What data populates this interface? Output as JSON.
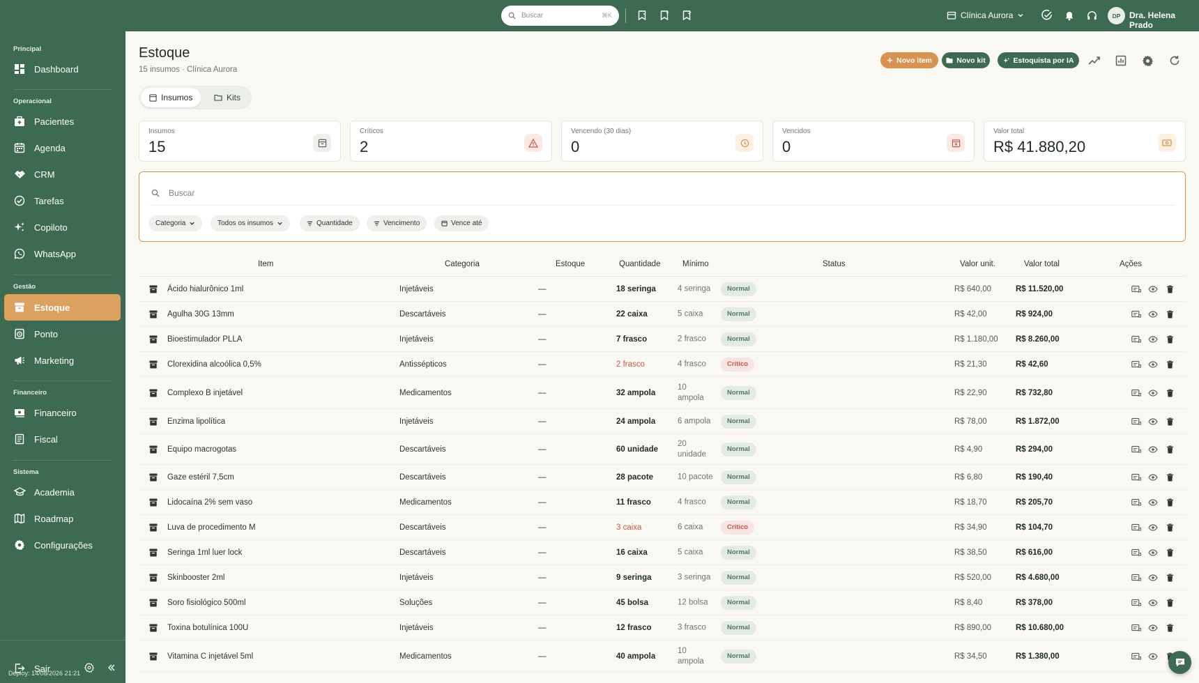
{
  "topbar": {
    "search_placeholder": "Buscar",
    "search_shortcut": "⌘K",
    "clinic_name": "Clínica Aurora",
    "user_initials": "DP",
    "user_name": "Dra. Helena Prado"
  },
  "sidebar": {
    "groups": {
      "principal": "Principal",
      "operacional": "Operacional",
      "gestao": "Gestão",
      "financeiro": "Financeiro",
      "sistema": "Sistema"
    },
    "items": {
      "dashboard": "Dashboard",
      "pacientes": "Pacientes",
      "agenda": "Agenda",
      "crm": "CRM",
      "tarefas": "Tarefas",
      "copiloto": "Copiloto",
      "whatsapp": "WhatsApp",
      "estoque": "Estoque",
      "ponto": "Ponto",
      "marketing": "Marketing",
      "financeiro": "Financeiro",
      "fiscal": "Fiscal",
      "academia": "Academia",
      "roadmap": "Roadmap",
      "configuracoes": "Configurações"
    },
    "logout": "Sair",
    "deploy": "Deploy: 14/08/2026 21:21"
  },
  "header": {
    "title": "Estoque",
    "subtitle": "15 insumos · Clínica Aurora",
    "btn_novo_item": "Novo item",
    "btn_novo_kit": "Novo kit",
    "btn_estoquista": "Estoquista por IA"
  },
  "tabs": {
    "insumos": "Insumos",
    "kits": "Kits"
  },
  "stats": {
    "insumos": {
      "label": "Insumos",
      "value": "15"
    },
    "criticos": {
      "label": "Críticos",
      "value": "2"
    },
    "vencendo": {
      "label": "Vencendo (30 dias)",
      "value": "0"
    },
    "vencidos": {
      "label": "Vencidos",
      "value": "0"
    },
    "valor": {
      "label": "Valor total",
      "value": "R$ 41.880,20"
    }
  },
  "filters": {
    "search_placeholder": "Buscar",
    "categoria": "Categoria",
    "todos": "Todos os insumos",
    "quantidade": "Quantidade",
    "vencimento": "Vencimento",
    "vence_ate": "Vence até"
  },
  "table": {
    "headers": {
      "item": "Item",
      "categoria": "Categoria",
      "estoque": "Estoque",
      "quantidade": "Quantidade",
      "minimo": "Mínimo",
      "status": "Status",
      "valor_unit": "Valor unit.",
      "valor_total": "Valor total",
      "acoes": "Ações"
    },
    "rows": [
      {
        "item": "Ácido hialurônico 1ml",
        "categoria": "Injetáveis",
        "estoque": "—",
        "quantidade": "18 seringa",
        "minimo": "4 seringa",
        "status": "Normal",
        "valor_unit": "R$ 640,00",
        "valor_total": "R$ 11.520,00"
      },
      {
        "item": "Agulha 30G 13mm",
        "categoria": "Descartáveis",
        "estoque": "—",
        "quantidade": "22 caixa",
        "minimo": "5 caixa",
        "status": "Normal",
        "valor_unit": "R$ 42,00",
        "valor_total": "R$ 924,00"
      },
      {
        "item": "Bioestimulador PLLA",
        "categoria": "Injetáveis",
        "estoque": "—",
        "quantidade": "7 frasco",
        "minimo": "2 frasco",
        "status": "Normal",
        "valor_unit": "R$ 1.180,00",
        "valor_total": "R$ 8.260,00"
      },
      {
        "item": "Clorexidina alcoólica 0,5%",
        "categoria": "Antissépticos",
        "estoque": "—",
        "quantidade": "2 frasco",
        "minimo": "4 frasco",
        "status": "Crítico",
        "valor_unit": "R$ 21,30",
        "valor_total": "R$ 42,60"
      },
      {
        "item": "Complexo B injetável",
        "categoria": "Medicamentos",
        "estoque": "—",
        "quantidade": "32 ampola",
        "minimo": "10 ampola",
        "status": "Normal",
        "valor_unit": "R$ 22,90",
        "valor_total": "R$ 732,80"
      },
      {
        "item": "Enzima lipolítica",
        "categoria": "Injetáveis",
        "estoque": "—",
        "quantidade": "24 ampola",
        "minimo": "6 ampola",
        "status": "Normal",
        "valor_unit": "R$ 78,00",
        "valor_total": "R$ 1.872,00"
      },
      {
        "item": "Equipo macrogotas",
        "categoria": "Descartáveis",
        "estoque": "—",
        "quantidade": "60 unidade",
        "minimo": "20 unidade",
        "status": "Normal",
        "valor_unit": "R$ 4,90",
        "valor_total": "R$ 294,00"
      },
      {
        "item": "Gaze estéril 7,5cm",
        "categoria": "Descartáveis",
        "estoque": "—",
        "quantidade": "28 pacote",
        "minimo": "10 pacote",
        "status": "Normal",
        "valor_unit": "R$ 6,80",
        "valor_total": "R$ 190,40"
      },
      {
        "item": "Lidocaína 2% sem vaso",
        "categoria": "Medicamentos",
        "estoque": "—",
        "quantidade": "11 frasco",
        "minimo": "4 frasco",
        "status": "Normal",
        "valor_unit": "R$ 18,70",
        "valor_total": "R$ 205,70"
      },
      {
        "item": "Luva de procedimento M",
        "categoria": "Descartáveis",
        "estoque": "—",
        "quantidade": "3 caixa",
        "minimo": "6 caixa",
        "status": "Crítico",
        "valor_unit": "R$ 34,90",
        "valor_total": "R$ 104,70"
      },
      {
        "item": "Seringa 1ml luer lock",
        "categoria": "Descartáveis",
        "estoque": "—",
        "quantidade": "16 caixa",
        "minimo": "5 caixa",
        "status": "Normal",
        "valor_unit": "R$ 38,50",
        "valor_total": "R$ 616,00"
      },
      {
        "item": "Skinbooster 2ml",
        "categoria": "Injetáveis",
        "estoque": "—",
        "quantidade": "9 seringa",
        "minimo": "3 seringa",
        "status": "Normal",
        "valor_unit": "R$ 520,00",
        "valor_total": "R$ 4.680,00"
      },
      {
        "item": "Soro fisiológico 500ml",
        "categoria": "Soluções",
        "estoque": "—",
        "quantidade": "45 bolsa",
        "minimo": "12 bolsa",
        "status": "Normal",
        "valor_unit": "R$ 8,40",
        "valor_total": "R$ 378,00"
      },
      {
        "item": "Toxina botulínica 100U",
        "categoria": "Injetáveis",
        "estoque": "—",
        "quantidade": "12 frasco",
        "minimo": "3 frasco",
        "status": "Normal",
        "valor_unit": "R$ 890,00",
        "valor_total": "R$ 10.680,00"
      },
      {
        "item": "Vitamina C injetável 5ml",
        "categoria": "Medicamentos",
        "estoque": "—",
        "quantidade": "40 ampola",
        "minimo": "10 ampola",
        "status": "Normal",
        "valor_unit": "R$ 34,50",
        "valor_total": "R$ 1.380,00"
      }
    ]
  },
  "colors": {
    "brand_green": "#3d6b52",
    "accent_orange": "#d9934f",
    "active_nav": "#dda15f",
    "critical_red": "#c9574a"
  }
}
